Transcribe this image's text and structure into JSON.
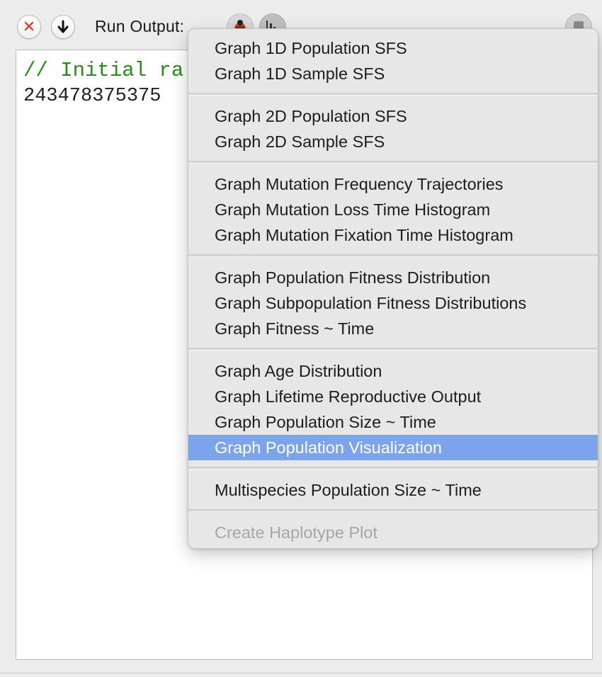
{
  "toolbar": {
    "clear_icon": "x-circle-icon",
    "dump_icon": "arrow-down-circle-icon",
    "run_output_label": "Run Output:",
    "debug_icon": "ladybug-icon",
    "graph_icon": "bar-chart-icon",
    "right_icon": "document-icon"
  },
  "output": {
    "line1": "// Initial ra",
    "line2": "243478375375"
  },
  "menu": {
    "groups": [
      {
        "items": [
          {
            "label": "Graph 1D Population SFS"
          },
          {
            "label": "Graph 1D Sample SFS"
          }
        ]
      },
      {
        "items": [
          {
            "label": "Graph 2D Population SFS"
          },
          {
            "label": "Graph 2D Sample SFS"
          }
        ]
      },
      {
        "items": [
          {
            "label": "Graph Mutation Frequency Trajectories"
          },
          {
            "label": "Graph Mutation Loss Time Histogram"
          },
          {
            "label": "Graph Mutation Fixation Time Histogram"
          }
        ]
      },
      {
        "items": [
          {
            "label": "Graph Population Fitness Distribution"
          },
          {
            "label": "Graph Subpopulation Fitness Distributions"
          },
          {
            "label": "Graph Fitness ~ Time"
          }
        ]
      },
      {
        "items": [
          {
            "label": "Graph Age Distribution"
          },
          {
            "label": "Graph Lifetime Reproductive Output"
          },
          {
            "label": "Graph Population Size ~ Time"
          },
          {
            "label": "Graph Population Visualization"
          }
        ]
      },
      {
        "items": [
          {
            "label": "Multispecies Population Size ~ Time"
          }
        ]
      },
      {
        "items": [
          {
            "label": "Create Haplotype Plot"
          }
        ]
      }
    ],
    "selected_item": "Graph Population Visualization",
    "disabled_item": "Create Haplotype Plot",
    "highlight_color": "#7ba4ec"
  }
}
